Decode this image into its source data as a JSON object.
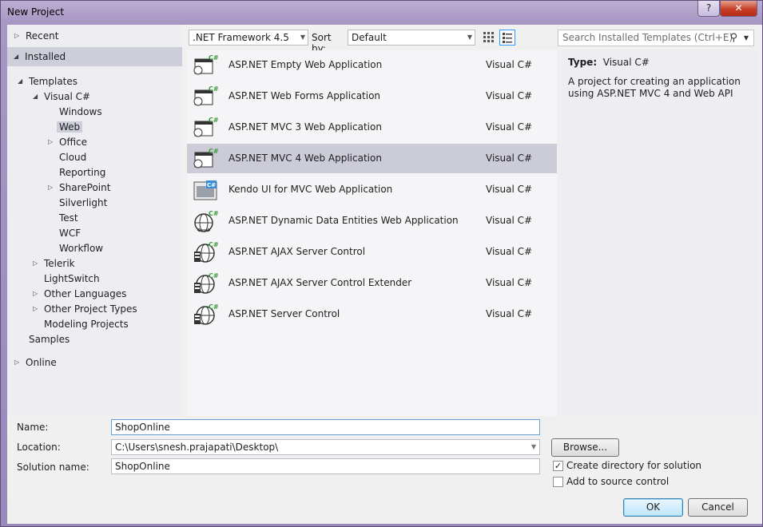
{
  "window": {
    "title": "New Project",
    "help_label": "?",
    "close_label": "✕"
  },
  "tree": {
    "recent": "Recent",
    "installed": "Installed",
    "templates": "Templates",
    "visual_csharp": "Visual C#",
    "windows": "Windows",
    "web": "Web",
    "office": "Office",
    "cloud": "Cloud",
    "reporting": "Reporting",
    "sharepoint": "SharePoint",
    "silverlight": "Silverlight",
    "test": "Test",
    "wcf": "WCF",
    "workflow": "Workflow",
    "telerik": "Telerik",
    "lightswitch": "LightSwitch",
    "other_languages": "Other Languages",
    "other_project_types": "Other Project Types",
    "modeling_projects": "Modeling Projects",
    "samples": "Samples",
    "online": "Online"
  },
  "toolbar": {
    "framework": ".NET Framework 4.5",
    "sort_label": "Sort by:",
    "sort_value": "Default"
  },
  "search": {
    "placeholder": "Search Installed Templates (Ctrl+E)"
  },
  "templates": [
    {
      "name": "ASP.NET Empty Web Application",
      "lang": "Visual C#"
    },
    {
      "name": "ASP.NET Web Forms Application",
      "lang": "Visual C#"
    },
    {
      "name": "ASP.NET MVC 3 Web Application",
      "lang": "Visual C#"
    },
    {
      "name": "ASP.NET MVC 4 Web Application",
      "lang": "Visual C#"
    },
    {
      "name": "Kendo UI for MVC Web Application",
      "lang": "Visual C#"
    },
    {
      "name": "ASP.NET Dynamic Data Entities Web Application",
      "lang": "Visual C#"
    },
    {
      "name": "ASP.NET AJAX Server Control",
      "lang": "Visual C#"
    },
    {
      "name": "ASP.NET AJAX Server Control Extender",
      "lang": "Visual C#"
    },
    {
      "name": "ASP.NET Server Control",
      "lang": "Visual C#"
    }
  ],
  "details": {
    "type_label": "Type:",
    "type_value": "Visual C#",
    "description": "A project for creating an application using ASP.NET MVC 4 and Web API"
  },
  "form": {
    "name_label": "Name:",
    "name_value": "ShopOnline",
    "location_label": "Location:",
    "location_value": "C:\\Users\\snesh.prajapati\\Desktop\\",
    "solution_label": "Solution name:",
    "solution_value": "ShopOnline",
    "browse_label": "Browse...",
    "create_dir_label": "Create directory for solution",
    "create_dir_checked": true,
    "source_control_label": "Add to source control",
    "source_control_checked": false,
    "ok_label": "OK",
    "cancel_label": "Cancel"
  },
  "colors": {
    "selection": "#cbccd8",
    "accent": "#3399ff",
    "csharp_badge": "#3a9a3a"
  }
}
